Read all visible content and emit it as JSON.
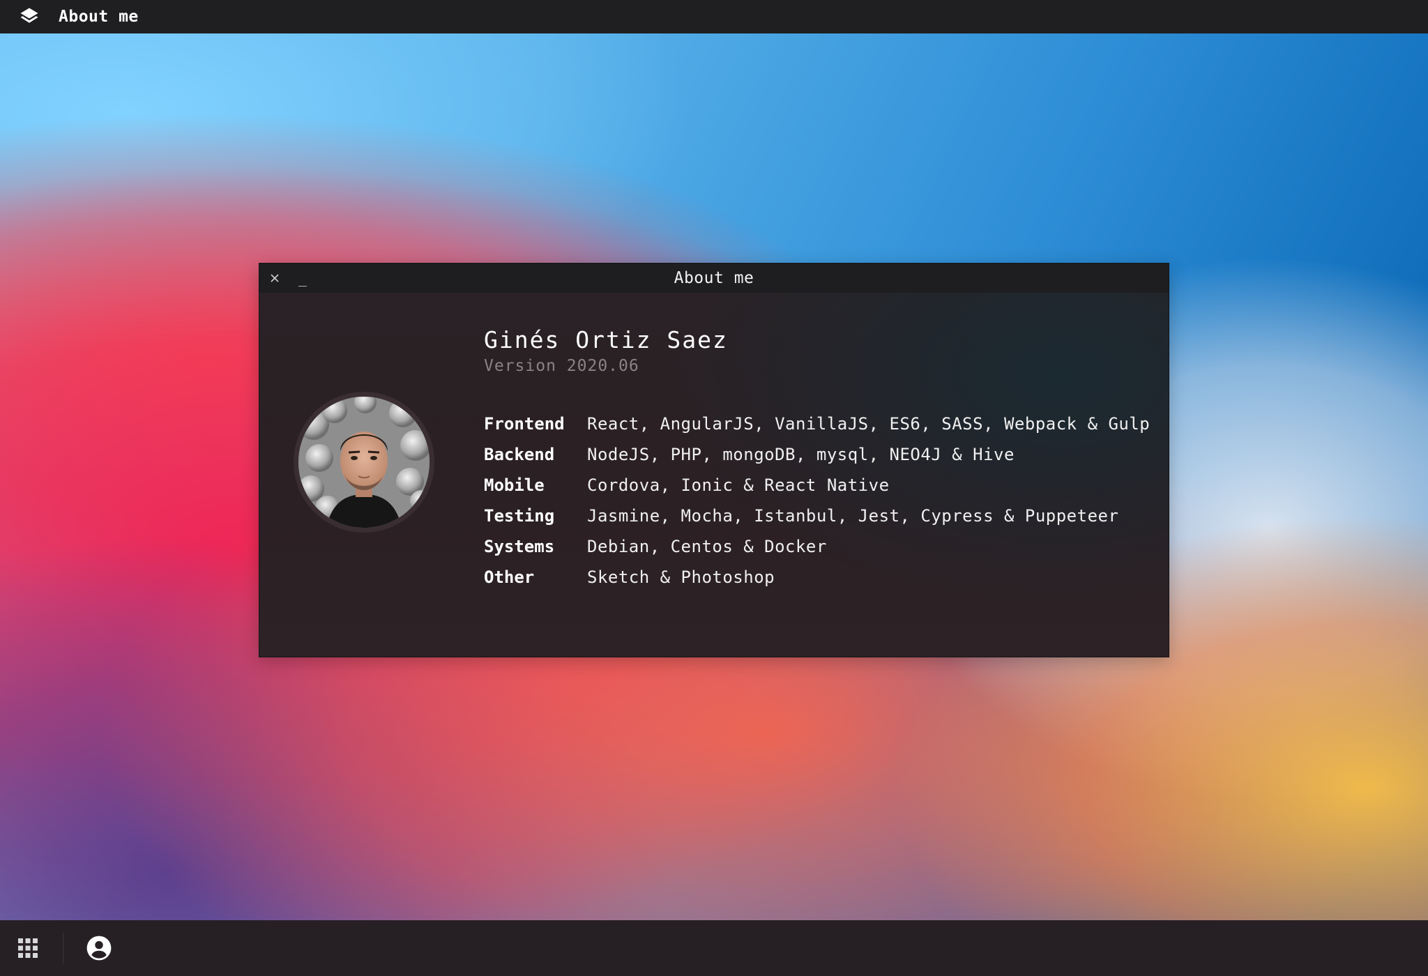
{
  "topbar": {
    "logo_icon": "layers-icon",
    "title": "About me"
  },
  "window": {
    "title": "About me",
    "close_icon": "close-icon",
    "minimize_label": "_",
    "profile": {
      "name": "Ginés Ortiz Saez",
      "version": "Version 2020.06"
    },
    "skills": [
      {
        "label": "Frontend",
        "value": "React, AngularJS, VanillaJS, ES6, SASS, Webpack & Gulp"
      },
      {
        "label": "Backend",
        "value": "NodeJS, PHP, mongoDB, mysql, NEO4J & Hive"
      },
      {
        "label": "Mobile",
        "value": "Cordova, Ionic & React Native"
      },
      {
        "label": "Testing",
        "value": "Jasmine, Mocha, Istanbul, Jest, Cypress & Puppeteer"
      },
      {
        "label": "Systems",
        "value": "Debian, Centos & Docker"
      },
      {
        "label": "Other",
        "value": "Sketch & Photoshop"
      }
    ]
  },
  "dock": {
    "apps_icon": "apps-grid-icon",
    "user_icon": "account-circle-icon"
  },
  "colors": {
    "bar": "#1f1f22",
    "window_bg": "#2a2226",
    "text": "#ffffff",
    "muted": "#8a8386"
  }
}
